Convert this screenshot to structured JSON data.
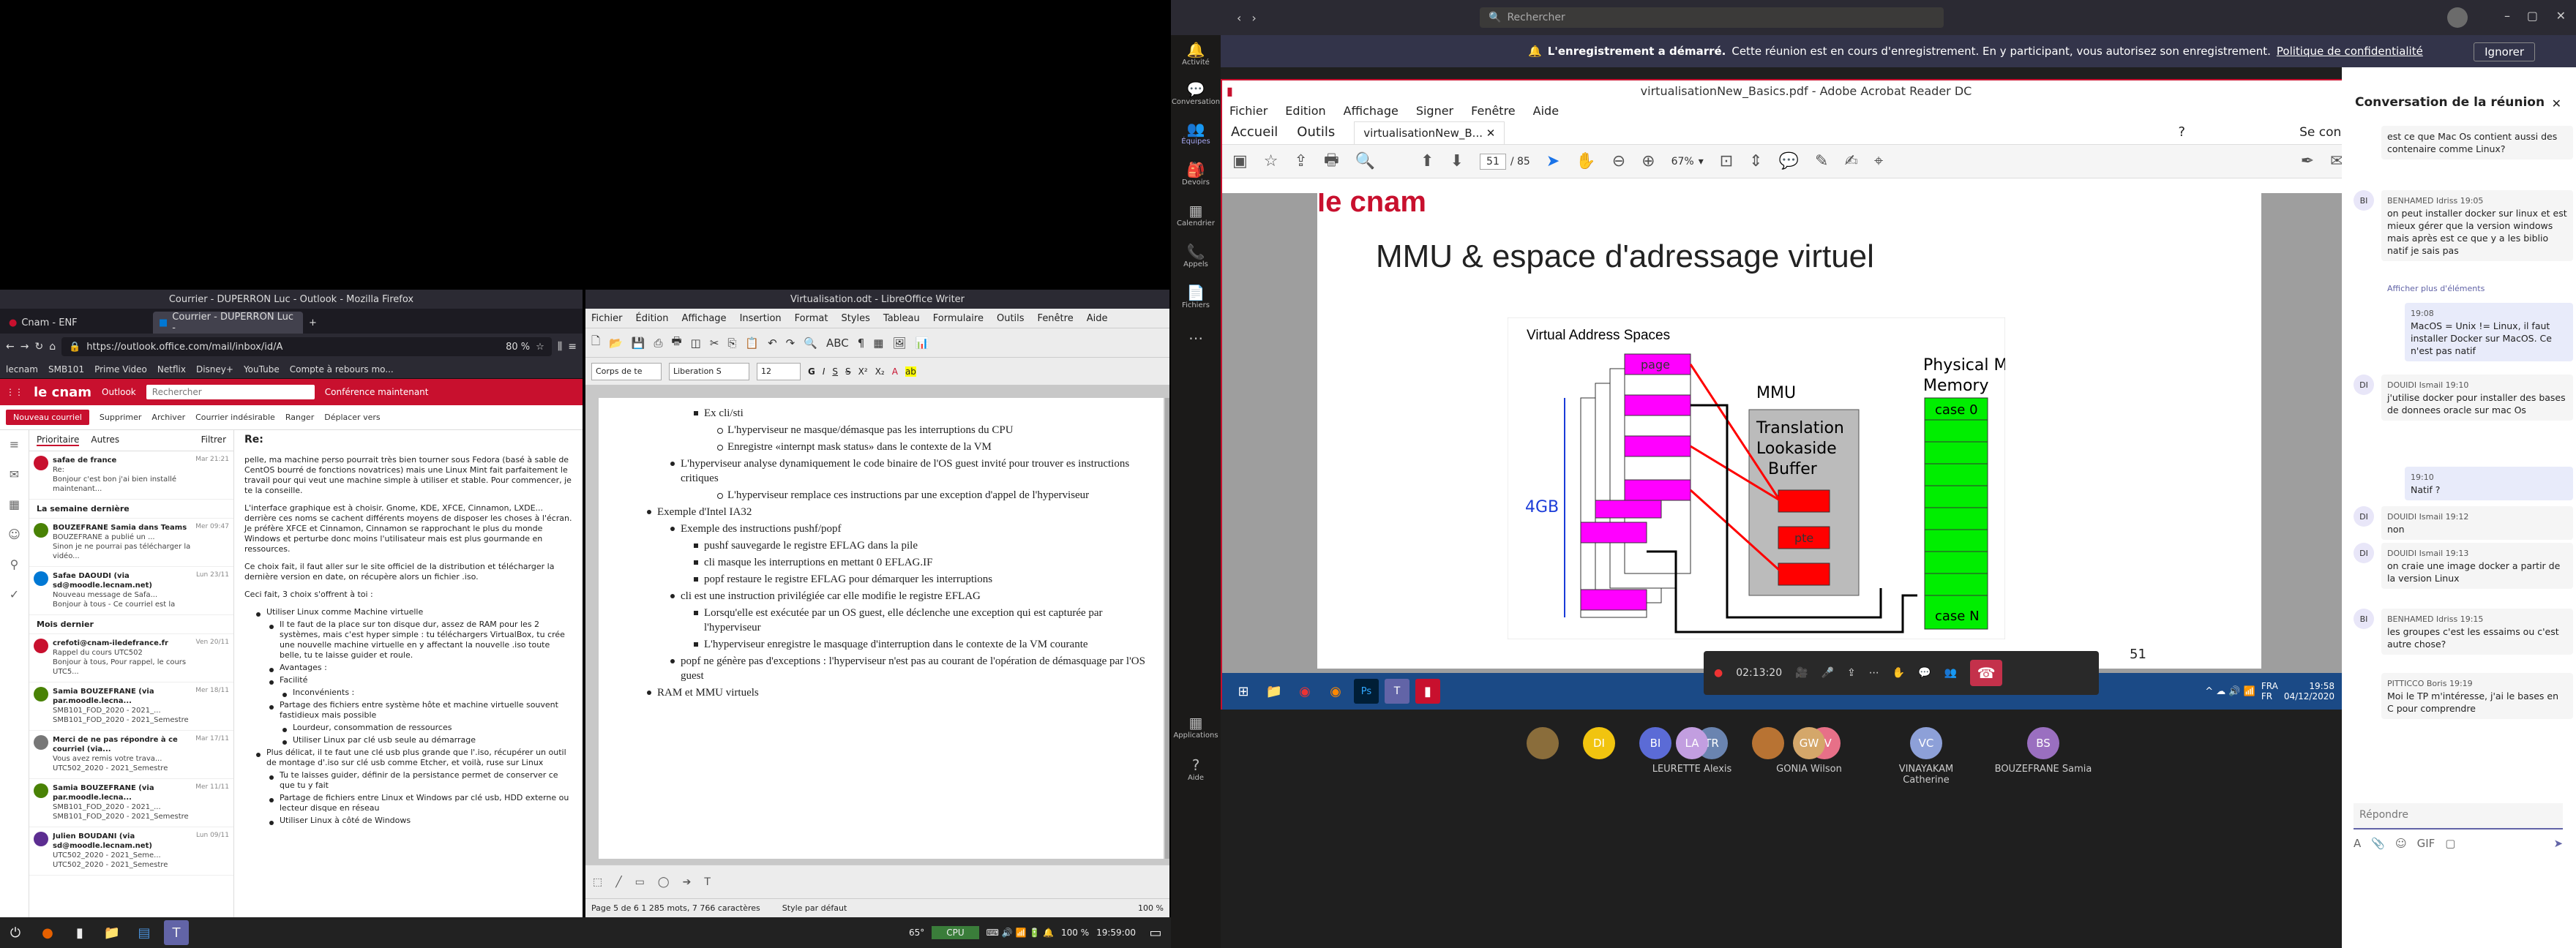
{
  "firefox": {
    "title": "Courrier - DUPERRON Luc - Outlook - Mozilla Firefox",
    "tabs": [
      {
        "label": "Cnam - ENF"
      },
      {
        "label": "Courrier - DUPERRON Luc - "
      }
    ],
    "url": "https://outlook.office.com/mail/inbox/id/A",
    "zoom": "80 %",
    "bookmarks": [
      "lecnam",
      "SMB101",
      "Prime Video",
      "Netflix",
      "Disney+",
      "YouTube",
      "Compte à rebours mo..."
    ],
    "outlook": {
      "brand": "le cnam",
      "app": "Outlook",
      "search": "Rechercher",
      "conf": "Conférence maintenant",
      "cmds": [
        "Nouveau courriel",
        "Supprimer",
        "Archiver",
        "Courrier indésirable",
        "Ranger",
        "Déplacer vers"
      ],
      "filters": [
        "Prioritaire",
        "Autres",
        "Filtrer"
      ],
      "reply_to": "Re:",
      "sections": [
        "La semaine dernière",
        "Mois dernier"
      ],
      "mails": [
        {
          "from": "safae de france",
          "sub": "Re:",
          "prev": "Bonjour c'est bon j'ai bien installé maintenant...",
          "date": "Mar 21:21",
          "color": "#c8102e"
        },
        {
          "from": "BOUZEFRANE Samia dans Teams",
          "sub": "BOUZEFRANE a publié un ...",
          "prev": "Sinon je ne pourrai pas télécharger la vidéo...",
          "date": "Mer 09:47",
          "color": "#498205"
        },
        {
          "from": "Safae DAOUDI (via sd@moodle.lecnam.net)",
          "sub": "Nouveau message de Safa...",
          "prev": "Bonjour à tous - Ce courriel est la copie d'un m...",
          "date": "Lun 23/11",
          "color": "#0078d4"
        },
        {
          "from": "crefoti@cnam-iledefrance.fr",
          "sub": "Rappel du cours UTC502",
          "prev": "Bonjour à tous, Pour rappel, le cours UTC5...",
          "date": "Ven 20/11",
          "color": "#c8102e"
        },
        {
          "from": "Samia BOUZEFRANE (via par.moodle.lecna...",
          "sub": "SMB101_FOD_2020 - 2021_...",
          "prev": "SMB101_FOD_2020 - 2021_Semestre 1_73053 -...",
          "date": "Mer 18/11",
          "color": "#498205"
        },
        {
          "from": "Merci de ne pas répondre à ce courriel (via...",
          "sub": "Vous avez remis votre trava...",
          "prev": "UTC502_2020 - 2021_Semestre 1_73053 -...",
          "date": "Mar 17/11",
          "color": "#777"
        },
        {
          "from": "Samia BOUZEFRANE (via par.moodle.lecna...",
          "sub": "SMB101_FOD_2020 - 2021_...",
          "prev": "SMB101_FOD_2020 - 2021_Semestre 1_73053 -...",
          "date": "Mer 11/11",
          "color": "#498205"
        },
        {
          "from": "Julien BOUDANI (via sd@moodle.lecnam.net)",
          "sub": "UTC502_2020 - 2021_Seme...",
          "prev": "UTC502_2020 - 2021_Semestre 1_73053 -...",
          "date": "Lun 09/11",
          "color": "#5c2d91"
        }
      ],
      "reading": [
        "pelle, ma machine perso pourrait très bien tourner sous Fedora (basé à sable de CentOS bourré de fonctions novatrices) mais une Linux Mint fait parfaitement le travail pour qui veut une machine simple à utiliser et stable. Pour commencer, je te la conseille.",
        "L'interface graphique est à choisir. Gnome, KDE, XFCE, Cinnamon, LXDE... derrière ces noms se cachent différents moyens de disposer les choses à l'écran. Je préfère XFCE et Cinnamon, Cinnamon se rapprochant le plus du monde Windows et perturbe donc moins l'utilisateur mais est plus gourmande en ressources.",
        "Ce choix fait, il faut aller sur le site officiel de la distribution et télécharger la dernière version en date, on récupère alors un fichier .iso.",
        "Ceci fait, 3 choix s'offrent à toi :"
      ],
      "reading_list": [
        "Utiliser Linux comme Machine virtuelle",
        "Il te faut de la place sur ton disque dur, assez de RAM pour les 2 systèmes, mais c'est hyper simple : tu téléchargers VirtualBox, tu crée une nouvelle machine virtuelle en y affectant la nouvelle .iso toute belle, tu te laisse guider et roule.",
        "Avantages :",
        "Facilité",
        "Inconvénients :",
        "Partage des fichiers entre système hôte et machine virtuelle souvent fastidieux mais possible",
        "Lourdeur, consommation de ressources",
        "Utiliser Linux par clé usb seule au démarrage",
        "Plus délicat, il te faut une clé usb plus grande que l'.iso, récupérer un outil de montage d'.iso sur clé usb comme Etcher, et voilà, ruse sur Linux",
        "Tu te laisses guider, définir de la persistance permet de conserver ce que tu y fait",
        "Partage de fichiers entre Linux et Windows par clé usb, HDD externe ou lecteur disque en réseau",
        "Utiliser Linux à côté de Windows"
      ]
    }
  },
  "writer": {
    "title": "Virtualisation.odt - LibreOffice Writer",
    "menu": [
      "Fichier",
      "Édition",
      "Affichage",
      "Insertion",
      "Format",
      "Styles",
      "Tableau",
      "Formulaire",
      "Outils",
      "Fenêtre",
      "Aide"
    ],
    "style": "Corps de te",
    "font": "Liberation S",
    "size": "12",
    "lines": [
      {
        "lvl": 3,
        "text": "Ex cli/sti"
      },
      {
        "lvl": 4,
        "text": "L'hyperviseur ne masque/démasque pas les interruptions du CPU"
      },
      {
        "lvl": 4,
        "text": "Enregistre «internpt mask status» dans le contexte de la VM"
      },
      {
        "lvl": 2,
        "text": "L'hyperviseur analyse dynamiquement le code binaire de l'OS guest invité pour trouver es instructions critiques"
      },
      {
        "lvl": 4,
        "text": "L'hyperviseur remplace ces instructions par une exception d'appel de l'hyperviseur"
      },
      {
        "lvl": 1,
        "text": "Exemple d'Intel IA32"
      },
      {
        "lvl": 2,
        "text": "Exemple des instructions pushf/popf"
      },
      {
        "lvl": 3,
        "text": "pushf sauvegarde le registre EFLAG dans la pile"
      },
      {
        "lvl": 3,
        "text": "cli masque les interruptions en mettant 0 EFLAG.IF"
      },
      {
        "lvl": 3,
        "text": "popf restaure le registre EFLAG pour démarquer les interruptions"
      },
      {
        "lvl": 2,
        "text": "cli est une instruction privilégiée car elle modifie le registre EFLAG"
      },
      {
        "lvl": 3,
        "text": "Lorsqu'elle est exécutée par un OS guest, elle déclenche une exception qui est capturée par l'hyperviseur"
      },
      {
        "lvl": 3,
        "text": "L'hyperviseur enregistre le masquage d'interruption dans le contexte de la VM courante"
      },
      {
        "lvl": 2,
        "text": "popf ne génère pas d'exceptions : l'hyperviseur n'est pas au courant de l'opération de démasquage par l'OS guest"
      },
      {
        "lvl": 1,
        "text": "RAM et MMU virtuels"
      }
    ],
    "status": [
      "Page 5 de 6   1 285 mots, 7 766 caractères",
      "Style par défaut",
      "100 %"
    ]
  },
  "taskbar": {
    "temp": "65°",
    "cpu": "CPU",
    "zoom": "100 %",
    "time": "19:59:00"
  },
  "teams": {
    "search": "Rechercher",
    "rail": [
      "Activité",
      "Conversation",
      "Équipes",
      "Devoirs",
      "Calendrier",
      "Appels",
      "Fichiers",
      "Applications",
      "Aide"
    ],
    "banner": {
      "bold": "L'enregistrement a démarré.",
      "text": "Cette réunion est en cours d'enregistrement. En y participant, vous autorisez son enregistrement.",
      "link": "Politique de confidentialité",
      "btn": "Ignorer"
    },
    "acrobat": {
      "title": "virtualisationNew_Basics.pdf - Adobe Acrobat Reader DC",
      "menu": [
        "Fichier",
        "Edition",
        "Affichage",
        "Signer",
        "Fenêtre",
        "Aide"
      ],
      "tabs": [
        "Accueil",
        "Outils",
        "virtualisationNew_B..."
      ],
      "signin": "Se connecter",
      "page": "51",
      "pages": "/ 85",
      "zoom": "67%",
      "slide": {
        "logo": "le cnam",
        "title": "MMU & espace d'adressage virtuel",
        "vas": "Virtual Address Spaces",
        "mmu": "MMU",
        "tlb": "Translation Lookaside Buffer",
        "pm": "Physical Memory",
        "size": "4GB",
        "page": "page",
        "pte": "pte",
        "case0": "case 0",
        "caseN": "case N",
        "num": "51"
      },
      "timer": "02:13:20",
      "win_time": "19:58",
      "win_date": "04/12/2020",
      "lang": "FRA",
      "lang2": "FR"
    },
    "participants": [
      {
        "i": "",
        "name": "",
        "c": "#8a6d3b"
      },
      {
        "i": "DI",
        "name": "",
        "c": "#f1c40f"
      },
      {
        "i": "BI",
        "name": "",
        "c": "#5b6bd6"
      },
      {
        "i": "TR",
        "name": "",
        "c": "#6a84b0"
      },
      {
        "i": "",
        "name": "",
        "c": "#b87333"
      },
      {
        "i": "TV",
        "name": "",
        "c": "#e77088"
      },
      {
        "i": "LA",
        "name": "LEURETTE Alexis",
        "c": "#c29ee0"
      },
      {
        "i": "GW",
        "name": "GONIA Wilson",
        "c": "#d4a76a"
      },
      {
        "i": "VC",
        "name": "VINAYAKAM Catherine",
        "c": "#8da0d8"
      },
      {
        "i": "BS",
        "name": "BOUZEFRANE Samia",
        "c": "#9a6fc0"
      }
    ],
    "chat": {
      "title": "Conversation de la réunion",
      "reply": "Répondre",
      "msgs": [
        {
          "i": "",
          "n": "",
          "text": "est ce que Mac Os contient aussi des contenaire comme Linux?",
          "me": false
        },
        {
          "i": "BI",
          "n": "BENHAMED Idriss 19:05",
          "text": "on peut installer docker sur linux et est mieux gérer que la version windows mais après est ce que y a les biblio natif je sais pas",
          "me": false
        },
        {
          "i": "",
          "n": "Afficher plus d'éléments",
          "text": "",
          "me": false
        },
        {
          "i": "",
          "n": "19:08",
          "text": "MacOS = Unix != Linux, il faut installer Docker sur MacOS. Ce n'est pas natif",
          "me": true
        },
        {
          "i": "DI",
          "n": "DOUIDI Ismail 19:10",
          "text": "j'utilise docker pour installer des bases de donnees oracle sur mac Os",
          "me": false
        },
        {
          "i": "",
          "n": "19:10",
          "text": "Natif ?",
          "me": true
        },
        {
          "i": "DI",
          "n": "DOUIDI Ismail 19:12",
          "text": "non",
          "me": false
        },
        {
          "i": "DI",
          "n": "DOUIDI Ismail 19:13",
          "text": "on craie une image docker a partir de la version Linux",
          "me": false
        },
        {
          "i": "BI",
          "n": "BENHAMED Idriss 19:15",
          "text": "les groupes c'est les essaims ou c'est autre chose?",
          "me": false
        },
        {
          "i": "",
          "n": "PITTICCO Boris 19:19",
          "text": "Moi le TP m'intéresse, j'ai le bases en C pour comprendre",
          "me": false
        }
      ]
    }
  }
}
